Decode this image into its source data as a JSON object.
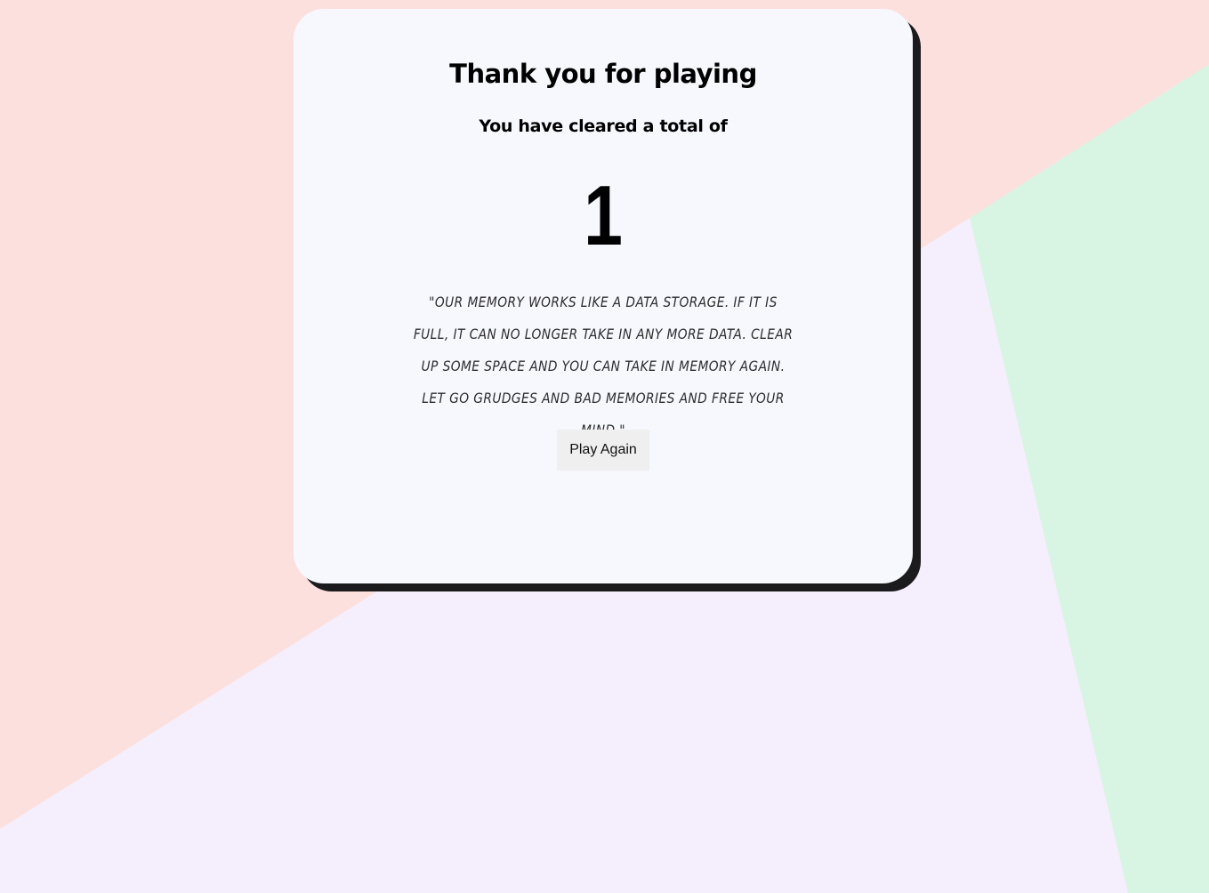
{
  "colors": {
    "bg_pink": "#fce0de",
    "bg_lavender": "#f5effd",
    "bg_mint": "#d8f5e4",
    "card": "#f7f8fe",
    "card_shadow": "#1b1a1c",
    "button": "#efefef"
  },
  "card": {
    "title": "Thank you for playing",
    "subtitle": "You have cleared a total of",
    "count": "1",
    "quote": "\"Our memory works like a data storage. If it is full, it can no longer take in any more data. Clear up some space and you can take in memory again. Let go grudges and bad memories and free your mind.\"",
    "play_again_label": "Play Again"
  }
}
